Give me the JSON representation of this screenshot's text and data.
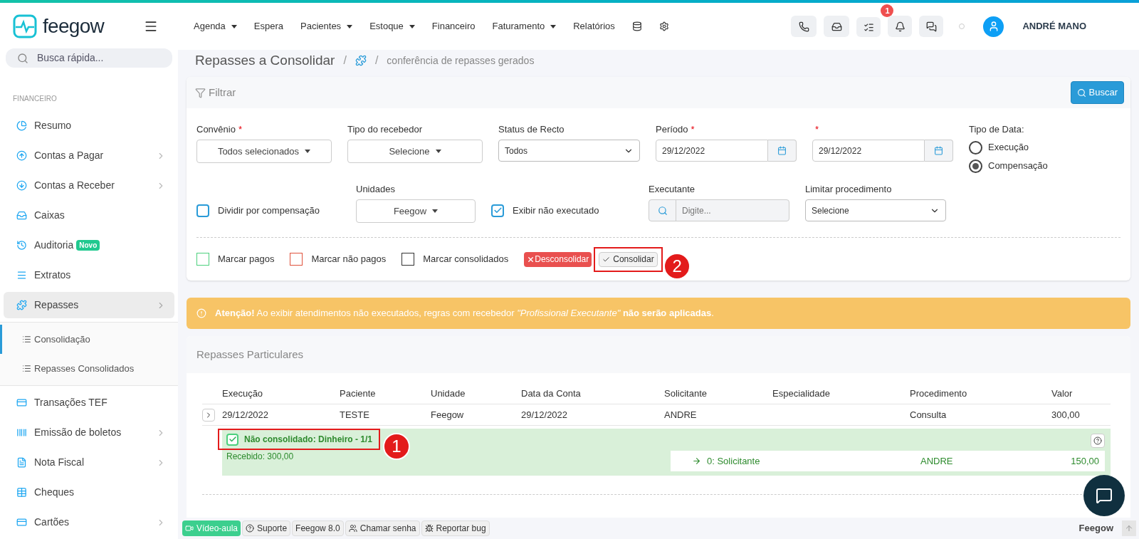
{
  "header": {
    "logo": "feegow",
    "nav": [
      {
        "label": "Agenda",
        "dropdown": true
      },
      {
        "label": "Espera",
        "dropdown": false
      },
      {
        "label": "Pacientes",
        "dropdown": true
      },
      {
        "label": "Estoque",
        "dropdown": true
      },
      {
        "label": "Financeiro",
        "dropdown": false
      },
      {
        "label": "Faturamento",
        "dropdown": true
      },
      {
        "label": "Relatórios",
        "dropdown": false
      }
    ],
    "task_badge": "1",
    "user": "ANDRÉ MANO"
  },
  "sidebar": {
    "search_placeholder": "Busca rápida...",
    "section": "FINANCEIRO",
    "items": [
      {
        "label": "Resumo",
        "chevron": false,
        "selected": false
      },
      {
        "label": "Contas a Pagar",
        "chevron": true,
        "selected": false
      },
      {
        "label": "Contas a Receber",
        "chevron": true,
        "selected": false
      },
      {
        "label": "Caixas",
        "chevron": false,
        "selected": false
      },
      {
        "label": "Auditoria",
        "badge": "Novo",
        "chevron": false,
        "selected": false
      },
      {
        "label": "Extratos",
        "chevron": false,
        "selected": false
      },
      {
        "label": "Repasses",
        "chevron": true,
        "selected": true,
        "expanded": true,
        "children": [
          {
            "label": "Consolidação",
            "selected": true
          },
          {
            "label": "Repasses Consolidados",
            "selected": false
          }
        ]
      },
      {
        "label": "Transações TEF",
        "chevron": false,
        "selected": false
      },
      {
        "label": "Emissão de boletos",
        "chevron": true,
        "selected": false
      },
      {
        "label": "Nota Fiscal",
        "chevron": true,
        "selected": false
      },
      {
        "label": "Cheques",
        "chevron": false,
        "selected": false
      },
      {
        "label": "Cartões",
        "chevron": true,
        "selected": false
      }
    ]
  },
  "breadcrumb": {
    "title": "Repasses a Consolidar",
    "separators": [
      "/",
      "/"
    ],
    "current": "conferência de repasses gerados"
  },
  "filter": {
    "title": "Filtrar",
    "search_button": "Buscar",
    "required_mark": "*",
    "row_1": [
      {
        "kind": "dropdown",
        "label": "Convênio",
        "required": true,
        "value": "Todos selecionados"
      },
      {
        "kind": "dropdown",
        "label": "Tipo do recebedor",
        "required": false,
        "value": "Selecione"
      },
      {
        "kind": "select",
        "label": "Status de Recto",
        "required": false,
        "value": "Todos"
      },
      {
        "kind": "date",
        "label": "Período",
        "required": true,
        "value": "29/12/2022"
      },
      {
        "kind": "date",
        "required": true,
        "value": "29/12/2022"
      },
      {
        "kind": "radio",
        "label": "Tipo de Data:",
        "required": false,
        "options": [
          {
            "label": "Execução",
            "selected": false
          },
          {
            "label": "Compensação",
            "selected": true
          }
        ]
      }
    ],
    "row_2": [
      {
        "kind": "checkbox",
        "label": "Dividir por compensação",
        "checked": false
      },
      {
        "kind": "dropdown",
        "label": "Unidades",
        "required": false,
        "value": "Feegow"
      },
      {
        "kind": "checkbox",
        "label": "Exibir não executado",
        "checked": true
      },
      {
        "kind": "search",
        "label": "Executante",
        "required": false,
        "placeholder": "Digite..."
      },
      {
        "kind": "select",
        "label": "Limitar procedimento",
        "required": false,
        "value": "Selecione"
      }
    ],
    "marks": [
      {
        "label": "Marcar pagos",
        "checked": false,
        "color": "#4cd07d"
      },
      {
        "label": "Marcar não pagos",
        "checked": false,
        "color": "#e0533d"
      },
      {
        "label": "Marcar consolidados",
        "checked": false,
        "color": "#333333"
      }
    ],
    "unconsolidate_button": "Desconsolidar",
    "consolidate_button": "Consolidar",
    "annotation": "2"
  },
  "alert": "**Atenção!** Ao exibir atendimentos não executados, regras com recebedor *\"Profissional Executante\"* **não serão aplicadas**.",
  "table": {
    "title": "Repasses Particulares",
    "columns": [
      "Execução",
      "Paciente",
      "Unidade",
      "Data da Conta",
      "Solicitante",
      "Especialidade",
      "Procedimento",
      "Valor"
    ],
    "rows": [
      {
        "cells": [
          "29/12/2022",
          "TESTE",
          "Feegow",
          "29/12/2022",
          "ANDRE",
          "",
          "Consulta",
          "300,00"
        ],
        "expanded": true,
        "detail": {
          "checked": true,
          "status": "Não consolidado: Dinheiro - 1/1",
          "received": "Recebido: 300,00",
          "annotation": "1",
          "splits": [
            {
              "role": "0: Solicitante",
              "name": "ANDRE",
              "value": "150,00"
            }
          ]
        }
      }
    ]
  },
  "footer": {
    "buttons": [
      {
        "label": "Vídeo-aula",
        "kind": "primary"
      },
      {
        "label": "Suporte",
        "kind": "help"
      },
      {
        "label": "Feegow 8.0",
        "kind": "plain"
      },
      {
        "label": "Chamar senha",
        "kind": "people"
      },
      {
        "label": "Reportar bug",
        "kind": "bug"
      }
    ],
    "brand": "Feegow"
  }
}
